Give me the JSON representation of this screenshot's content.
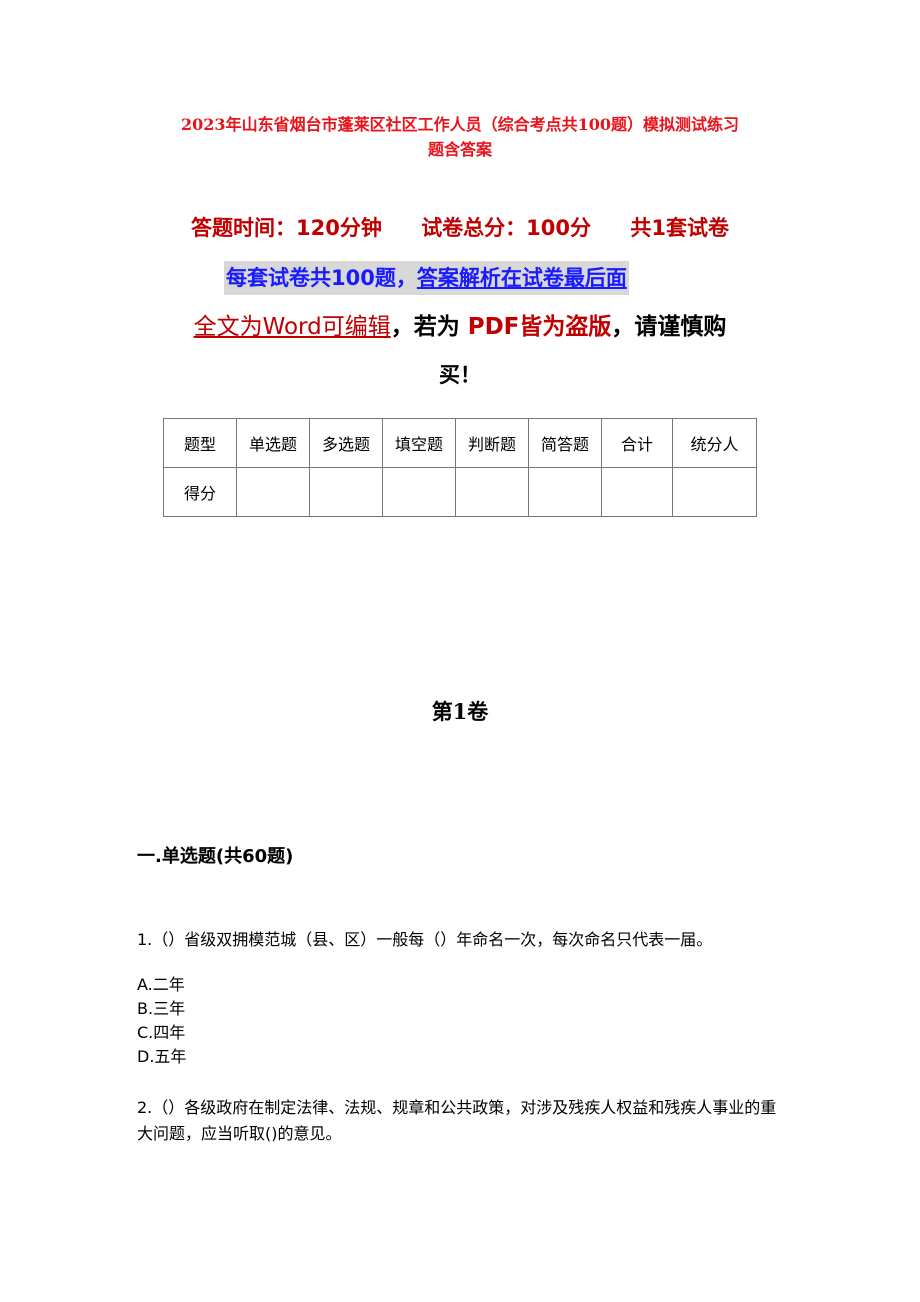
{
  "document": {
    "title_line1": "2023年山东省烟台市蓬莱区社区工作人员（综合考点共100题）模拟测试练习",
    "title_line2": "题含答案",
    "meta": {
      "time": "答题时间：120分钟",
      "total": "试卷总分：100分",
      "sets": "共1套试卷"
    },
    "notice": {
      "part1": "每套试卷共100题，",
      "part2": "答案解析在试卷最后面"
    },
    "warning": {
      "part1": "全文为Word可编辑",
      "part2": "，若为",
      "part3": "PDF皆为盗版",
      "part4": "，请谨慎购",
      "part5": "买！"
    },
    "score_table": {
      "headers": [
        "题型",
        "单选题",
        "多选题",
        "填空题",
        "判断题",
        "简答题",
        "合计",
        "统分人"
      ],
      "row": [
        "得分",
        "",
        "",
        "",
        "",
        "",
        "",
        ""
      ]
    },
    "volume_title": "第1卷",
    "section_title": "一.单选题(共60题)",
    "questions": [
      {
        "text": "1.（）省级双拥模范城（县、区）一般每（）年命名一次，每次命名只代表一届。",
        "options": [
          "A.二年",
          "B.三年",
          "C.四年",
          "D.五年"
        ]
      },
      {
        "text": "2.（）各级政府在制定法律、法规、规章和公共政策，对涉及残疾人权益和残疾人事业的重大问题，应当听取()的意见。"
      }
    ]
  }
}
